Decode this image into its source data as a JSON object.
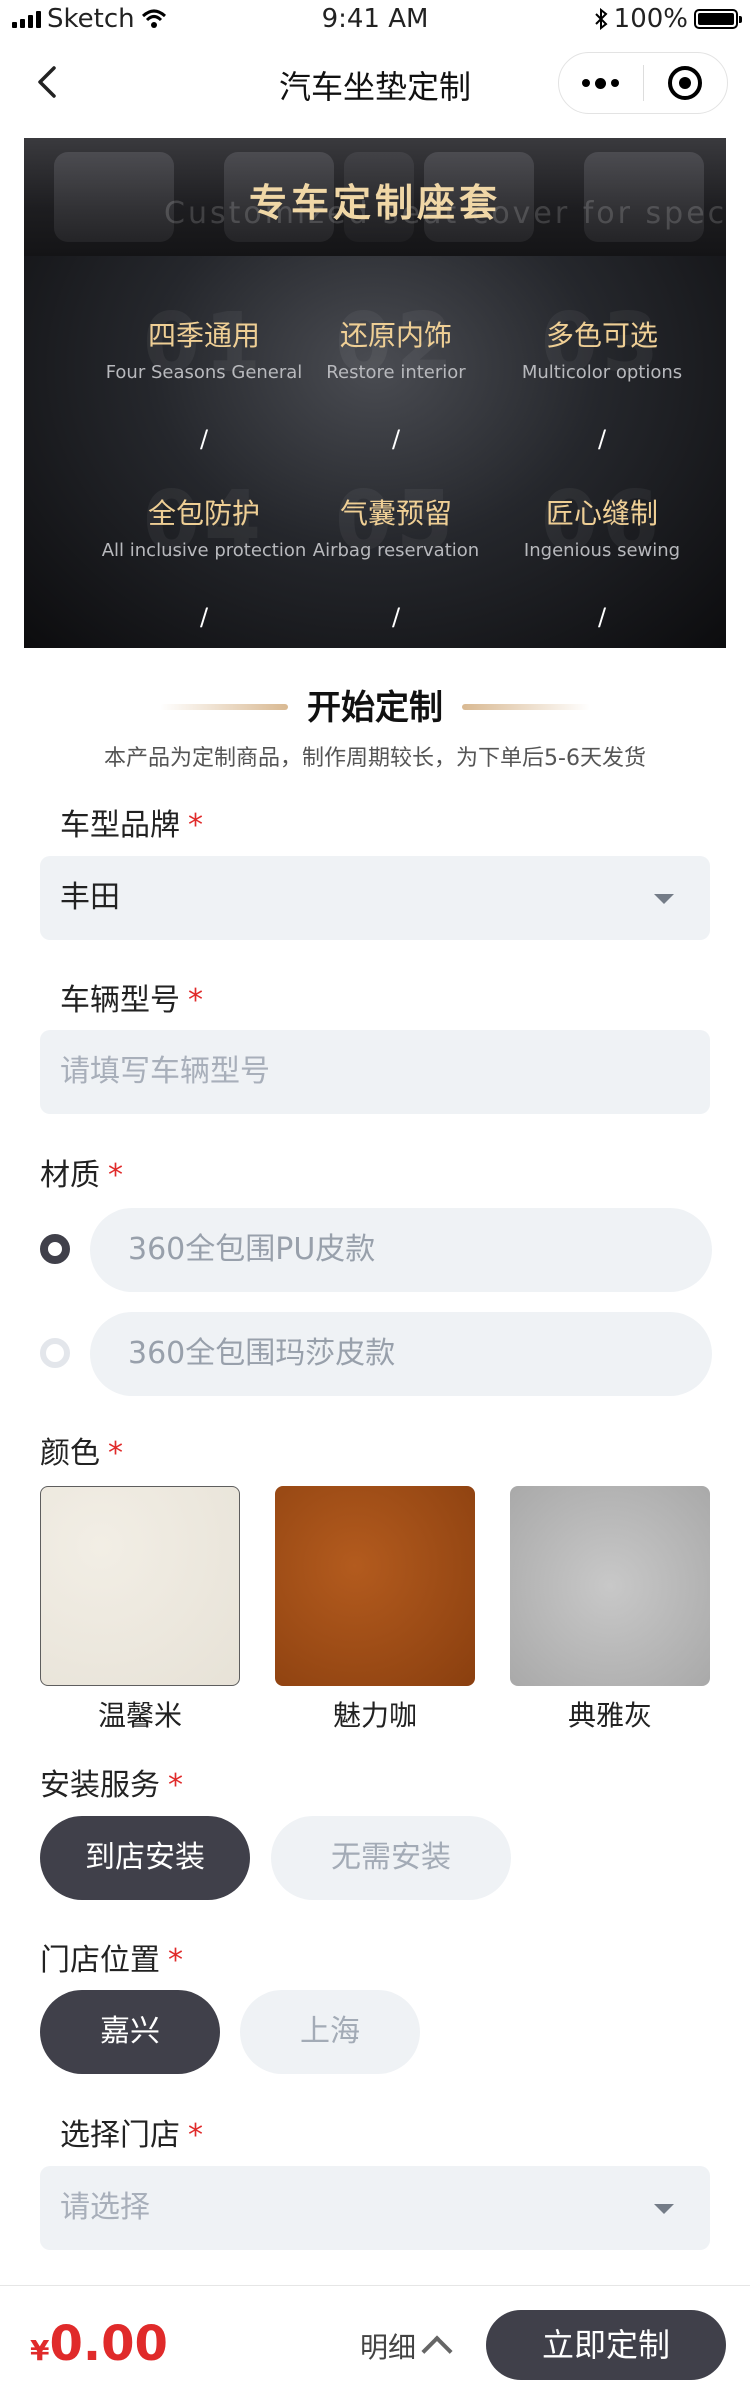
{
  "status_bar": {
    "carrier": "Sketch",
    "time": "9:41 AM",
    "battery": "100%"
  },
  "nav": {
    "title": "汽车坐垫定制"
  },
  "banner": {
    "title": "专车定制座套",
    "subtitle_ghost": "Customized seat cover for special car",
    "features": [
      {
        "num": "01",
        "cn": "四季通用",
        "en": "Four Seasons General",
        "mark": "/"
      },
      {
        "num": "02",
        "cn": "还原内饰",
        "en": "Restore interior",
        "mark": "/"
      },
      {
        "num": "03",
        "cn": "多色可选",
        "en": "Multicolor options",
        "mark": "/"
      },
      {
        "num": "04",
        "cn": "全包防护",
        "en": "All inclusive protection",
        "mark": "/"
      },
      {
        "num": "05",
        "cn": "气囊预留",
        "en": "Airbag reservation",
        "mark": "/"
      },
      {
        "num": "06",
        "cn": "匠心缝制",
        "en": "Ingenious sewing",
        "mark": "/"
      }
    ]
  },
  "section": {
    "title": "开始定制",
    "subtitle": "本产品为定制商品，制作周期较长，为下单后5-6天发货"
  },
  "form": {
    "required_mark": "*",
    "brand": {
      "label": "车型品牌",
      "value": "丰田"
    },
    "model": {
      "label": "车辆型号",
      "placeholder": "请填写车辆型号"
    },
    "material": {
      "label": "材质",
      "options": [
        "360全包围PU皮款",
        "360全包围玛莎皮款"
      ],
      "selected_index": 0
    },
    "color": {
      "label": "颜色",
      "options": [
        "温馨米",
        "魅力咖",
        "典雅灰"
      ],
      "swatch_colors": [
        "#ece8df",
        "#9c4a16",
        "#b9b9b9"
      ]
    },
    "install": {
      "label": "安装服务",
      "options": [
        "到店安装",
        "无需安装"
      ],
      "selected_index": 0
    },
    "store_location": {
      "label": "门店位置",
      "options": [
        "嘉兴",
        "上海"
      ],
      "selected_index": 0
    },
    "store": {
      "label": "选择门店",
      "placeholder": "请选择"
    }
  },
  "footer": {
    "currency": "¥",
    "price": "0.00",
    "detail_label": "明细",
    "cta_label": "立即定制"
  },
  "colors": {
    "accent_dark": "#40404a",
    "price_red": "#e02a2a",
    "field_bg": "#eff2f5",
    "gold": "#efcf95"
  }
}
